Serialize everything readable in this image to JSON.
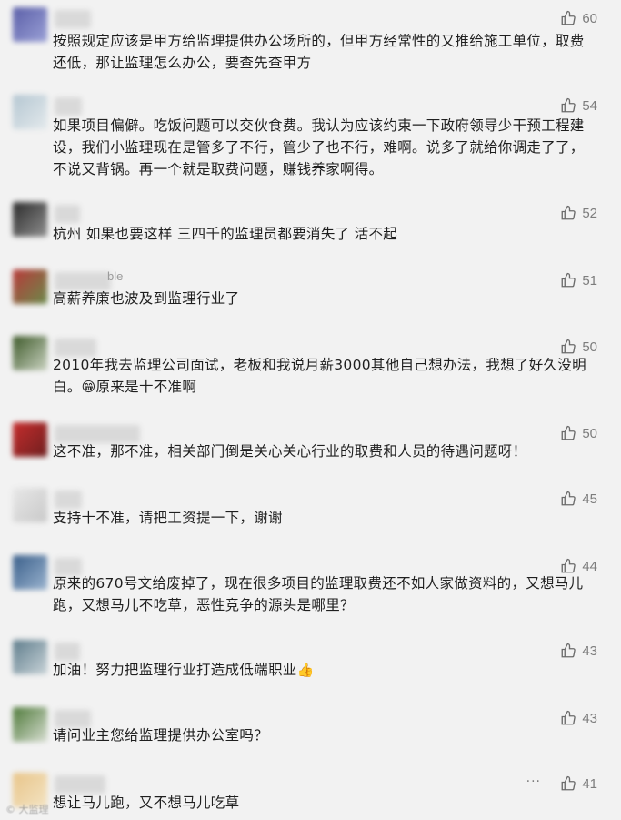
{
  "comments": [
    {
      "likes": "60",
      "text": "按照规定应该是甲方给监理提供办公场所的，但甲方经常性的又推给施工单位，取费还低，那让监理怎么办公，要查先查甲方",
      "avatar_colors": [
        "#5b5fa8",
        "#9aa0d6"
      ]
    },
    {
      "likes": "54",
      "text": "如果项目偏僻。吃饭问题可以交伙食费。我认为应该约束一下政府领导少干预工程建设，我们小监理现在是管多了不行，管少了也不行，难啊。说多了就给你调走了了，不说又背锅。再一个就是取费问题，赚钱养家啊得。",
      "avatar_colors": [
        "#b5c7d2",
        "#e3e9ec"
      ]
    },
    {
      "likes": "52",
      "text": "杭州 如果也要这样 三四千的监理员都要消失了 活不起",
      "avatar_colors": [
        "#2b2b2b",
        "#8f8f8f"
      ]
    },
    {
      "likes": "51",
      "text": "高薪养廉也波及到监理行业了",
      "nick_suffix": "ble",
      "avatar_colors": [
        "#b83a3a",
        "#6a8a4a"
      ]
    },
    {
      "likes": "50",
      "text": "2010年我去监理公司面试，老板和我说月薪3000其他自己想办法，我想了好久没明白。",
      "text_tail": "原来是十不准啊",
      "emoji": "😁",
      "avatar_colors": [
        "#3e5a2a",
        "#c9d2c0"
      ]
    },
    {
      "likes": "50",
      "text": "这不准，那不准，相关部门倒是关心关心行业的取费和人员的待遇问题呀！",
      "avatar_colors": [
        "#c62d2d",
        "#6e1f1f"
      ]
    },
    {
      "likes": "45",
      "text": "支持十不准，请把工资提一下，谢谢",
      "avatar_colors": [
        "#e7e7e7",
        "#c9c9c9"
      ]
    },
    {
      "likes": "44",
      "text": "原来的670号文给废掉了，现在很多项目的监理取费还不如人家做资料的，又想马儿跑，又想马儿不吃草，恶性竞争的源头是哪里？",
      "avatar_colors": [
        "#3a5f8a",
        "#9ab3cf"
      ]
    },
    {
      "likes": "43",
      "text": "加油！努力把监理行业打造成低端职业",
      "emoji": "👍",
      "avatar_colors": [
        "#5f7d8c",
        "#c8d3d8"
      ]
    },
    {
      "likes": "43",
      "text": "请问业主您给监理提供办公室吗？",
      "avatar_colors": [
        "#4f7a3a",
        "#d6ddd0"
      ]
    },
    {
      "likes": "41",
      "text": "想让马儿跑，又不想马儿吃草",
      "more": "···",
      "avatar_colors": [
        "#e8c58a",
        "#f3e3c2"
      ]
    }
  ],
  "watermark": "© 大监理",
  "colors": {
    "background": "#f2f2f2",
    "text": "#1f1f1f",
    "meta": "#7d7d7d"
  },
  "icon": "thumbs-up-icon"
}
